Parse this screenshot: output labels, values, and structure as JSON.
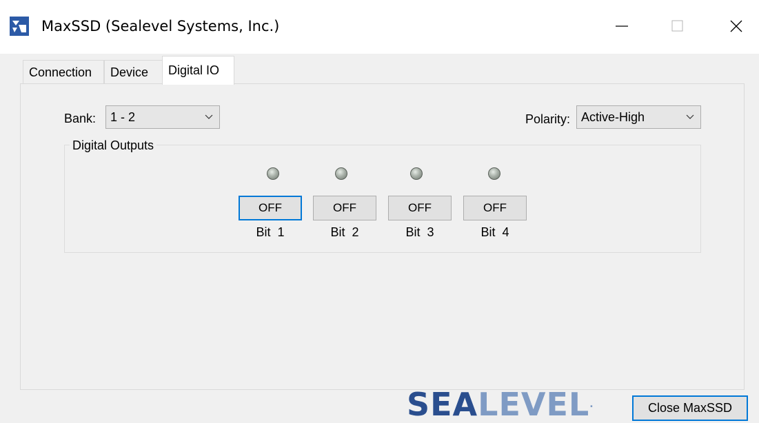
{
  "window": {
    "title": "MaxSSD (Sealevel Systems, Inc.)",
    "icons": {
      "app": "sealevel-app-icon",
      "minimize": "minimize-icon",
      "maximize": "maximize-icon",
      "close": "close-icon"
    }
  },
  "tabs": [
    {
      "label": "Connection",
      "active": false
    },
    {
      "label": "Device",
      "active": false
    },
    {
      "label": "Digital IO",
      "active": true
    }
  ],
  "bank": {
    "label": "Bank:",
    "value": "1 - 2"
  },
  "polarity": {
    "label": "Polarity:",
    "value": "Active-High"
  },
  "digital_outputs": {
    "label": "Digital Outputs",
    "bits": [
      {
        "label": "Bit  1",
        "state": "OFF",
        "led": "off"
      },
      {
        "label": "Bit  2",
        "state": "OFF",
        "led": "off"
      },
      {
        "label": "Bit  3",
        "state": "OFF",
        "led": "off"
      },
      {
        "label": "Bit  4",
        "state": "OFF",
        "led": "off"
      }
    ]
  },
  "footer": {
    "logo": {
      "part1": "SEA",
      "part2": "LEVEL",
      "mark": "."
    },
    "close_label": "Close MaxSSD"
  },
  "colors": {
    "focus": "#0078d7",
    "logo_dark": "#2a4e8e",
    "logo_light": "#7f9bc4"
  }
}
